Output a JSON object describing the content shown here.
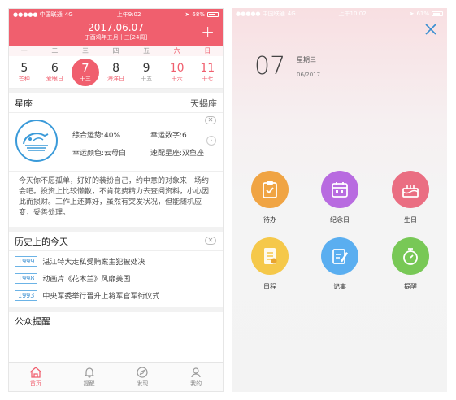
{
  "left_screen": {
    "status": {
      "carrier": "●●●●● 中国联通",
      "network": "4G",
      "time": "上午9:02",
      "battery": "68%"
    },
    "header": {
      "date": "2017.06.07",
      "lunar": "丁酉鸡年五月十三[24周]",
      "add_label": "+"
    },
    "week_days": [
      "一",
      "二",
      "三",
      "四",
      "五",
      "六",
      "日"
    ],
    "days": [
      {
        "num": "5",
        "label": "芒种"
      },
      {
        "num": "6",
        "label": "爱眼日"
      },
      {
        "num": "7",
        "label": "十三"
      },
      {
        "num": "8",
        "label": "海洋日"
      },
      {
        "num": "9",
        "label": "十五"
      },
      {
        "num": "10",
        "label": "十六"
      },
      {
        "num": "11",
        "label": "十七"
      }
    ],
    "horoscope": {
      "title": "星座",
      "sign": "天蝎座",
      "overall_label": "综合运势:",
      "overall_value": "40%",
      "lucky_number_label": "幸运数字:",
      "lucky_number_value": "6",
      "lucky_color_label": "幸运颜色:",
      "lucky_color_value": "云母白",
      "match_label": "速配星座:",
      "match_value": "双鱼座",
      "text": "今天你不愿孤单，好好的装扮自己，约中意的对象来一场约会吧。投资上比较懒散，不肯花费精力去查阅资料，小心因此而损财。工作上还算好，虽然有突发状况，但能随机应变，妥善处理。"
    },
    "history": {
      "title": "历史上的今天",
      "items": [
        {
          "year": "1999",
          "event": "湛江特大走私受贿案主犯被处决"
        },
        {
          "year": "1998",
          "event": "动画片《花木兰》风靡美国"
        },
        {
          "year": "1993",
          "event": "中央军委举行晋升上将军官军衔仪式"
        }
      ]
    },
    "public_reminder": {
      "title": "公众提醒"
    },
    "tabs": [
      {
        "label": "首页",
        "icon": "home-icon"
      },
      {
        "label": "提醒",
        "icon": "bell-icon"
      },
      {
        "label": "发现",
        "icon": "compass-icon"
      },
      {
        "label": "我的",
        "icon": "user-icon"
      }
    ],
    "colors": {
      "accent": "#f05f6e",
      "link_blue": "#3b8fd1"
    }
  },
  "right_screen": {
    "status": {
      "carrier": "●●●●● 中国联通",
      "network": "4G",
      "time": "上午10:02",
      "battery": "61%"
    },
    "date": {
      "day": "07",
      "weekday": "星期三",
      "month_year": "06/2017"
    },
    "actions": [
      {
        "label": "待办",
        "icon": "clipboard-check-icon",
        "color": "#f0a443"
      },
      {
        "label": "纪念日",
        "icon": "calendar-icon",
        "color": "#b86be0"
      },
      {
        "label": "生日",
        "icon": "cake-icon",
        "color": "#ea6e82"
      },
      {
        "label": "日程",
        "icon": "schedule-doc-icon",
        "color": "#f5c84a"
      },
      {
        "label": "记事",
        "icon": "note-pencil-icon",
        "color": "#5aaef0"
      },
      {
        "label": "提醒",
        "icon": "stopwatch-icon",
        "color": "#78c856"
      }
    ]
  }
}
